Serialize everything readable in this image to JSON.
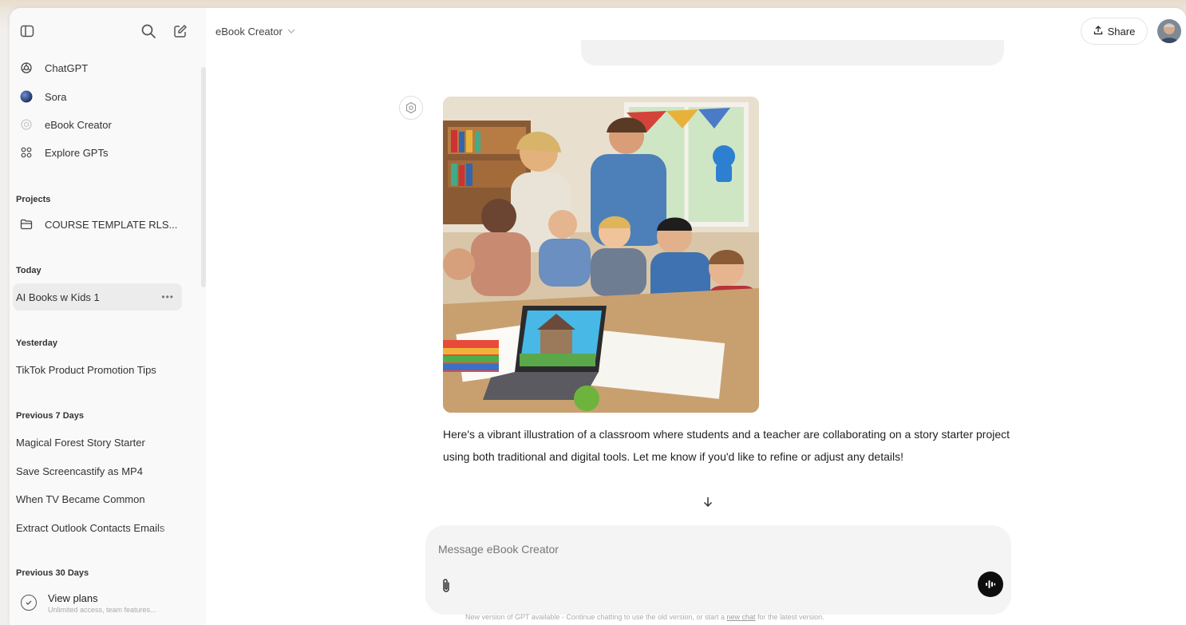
{
  "sidebar": {
    "nav": [
      {
        "label": "ChatGPT",
        "icon": "chatgpt-logo-icon"
      },
      {
        "label": "Sora",
        "icon": "sora-logo-icon"
      },
      {
        "label": "eBook Creator",
        "icon": "gpt-icon"
      },
      {
        "label": "Explore GPTs",
        "icon": "grid-icon"
      }
    ],
    "projects_label": "Projects",
    "project_item": "COURSE TEMPLATE RLS...",
    "today_label": "Today",
    "today_items": [
      "AI Books w Kids 1"
    ],
    "yesterday_label": "Yesterday",
    "yesterday_items": [
      "TikTok Product Promotion Tips"
    ],
    "prev7_label": "Previous 7 Days",
    "prev7_items": [
      "Magical Forest Story Starter",
      "Save Screencastify as MP4",
      "When TV Became Common",
      "Extract Outlook Contacts Emails"
    ],
    "prev30_label": "Previous 30 Days",
    "plans": {
      "title": "View plans",
      "subtitle": "Unlimited access, team features..."
    }
  },
  "header": {
    "model_name": "eBook Creator",
    "share_label": "Share"
  },
  "chat": {
    "reply_text": "Here's a vibrant illustration of a classroom where students and a teacher are collaborating on a story starter project using both traditional and digital tools. Let me know if you'd like to refine or adjust any details!"
  },
  "composer": {
    "placeholder": "Message eBook Creator"
  },
  "footer": {
    "notice_start": "New version of GPT available - Continue chatting to use the old version, or start a ",
    "notice_link": "new chat",
    "notice_end": " for the latest version."
  },
  "colors": {
    "sidebar_bg": "#f9f9f9",
    "active_item_bg": "#ececec",
    "composer_bg": "#f4f4f4",
    "voice_button": "#0d0d0d"
  }
}
